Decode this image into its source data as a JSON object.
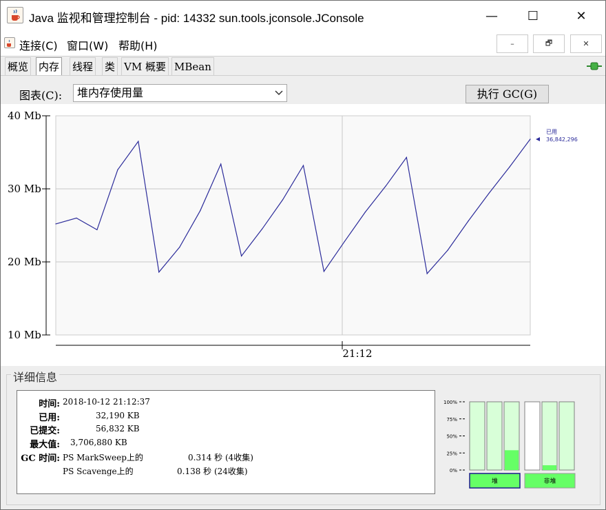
{
  "window": {
    "title": "Java 监视和管理控制台 - pid: 14332 sun.tools.jconsole.JConsole",
    "minimize_glyph": "—",
    "maximize_glyph": "☐",
    "close_glyph": "✕",
    "mdi_min": "–",
    "mdi_restore": "🗗",
    "mdi_close": "✕"
  },
  "menu": {
    "items": [
      {
        "label": "连接(C)"
      },
      {
        "label": "窗口(W)"
      },
      {
        "label": "帮助(H)"
      }
    ]
  },
  "tabs": [
    {
      "label": "概览",
      "active": false
    },
    {
      "label": "内存",
      "active": true
    },
    {
      "label": "线程",
      "active": false
    },
    {
      "label": "类",
      "active": false
    },
    {
      "label": "VM 概要",
      "active": false
    },
    {
      "label": "MBean",
      "active": false
    }
  ],
  "toolbar": {
    "chart_label": "图表(C):",
    "chart_selected": "堆内存使用量",
    "gc_button": "执行 GC(G)"
  },
  "chart_data": {
    "type": "line",
    "title": "",
    "y_ticks": [
      "40 Mb",
      "30 Mb",
      "20 Mb",
      "10 Mb"
    ],
    "y_tick_values": [
      40,
      30,
      20,
      10
    ],
    "ylim": [
      10,
      40
    ],
    "x_tick": "21:12",
    "series": [
      {
        "name": "已用",
        "color": "#2b2b9a",
        "values": [
          25.2,
          26.0,
          24.4,
          32.6,
          36.5,
          18.6,
          22.0,
          27.0,
          33.4,
          20.8,
          24.5,
          28.5,
          33.2,
          18.7,
          22.8,
          26.8,
          30.4,
          34.3,
          18.4,
          21.6,
          25.6,
          29.4,
          33.0,
          36.8
        ]
      }
    ],
    "current_label": "已用",
    "current_value": "36,842,296"
  },
  "details": {
    "title": "详细信息",
    "rows": {
      "time_label": "时间:",
      "time_value": "2018-10-12 21:12:37",
      "used_label": "已用:",
      "used_value": "32,190 KB",
      "committed_label": "已提交:",
      "committed_value": "56,832 KB",
      "max_label": "最大值:",
      "max_value": "3,706,880 KB",
      "gc_label": "GC 时间:",
      "gc1_name": "PS MarkSweep上的",
      "gc1_value": "0.314 秒 (4收集)",
      "gc2_name": "PS Scavenge上的",
      "gc2_value": "0.138 秒 (24收集)"
    }
  },
  "pool_bars": {
    "ticks": [
      "100%",
      "75%",
      "50%",
      "25%",
      "0%"
    ],
    "heap_label": "堆",
    "nonheap_label": "非堆",
    "heap_fills": [
      0,
      0,
      0.29
    ],
    "nonheap_fills": [
      0,
      0.07,
      0
    ]
  }
}
